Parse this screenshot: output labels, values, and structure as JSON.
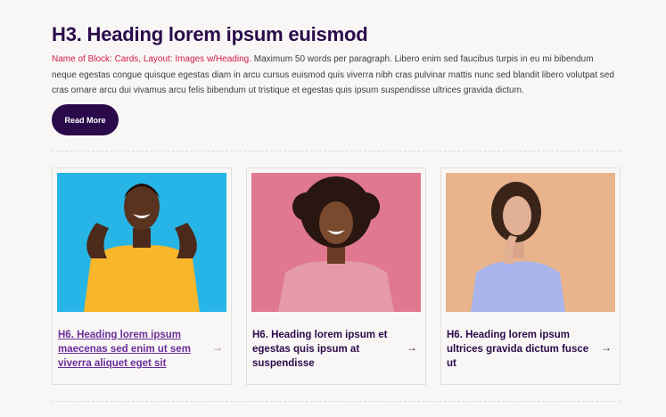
{
  "header": {
    "title": "H3. Heading lorem ipsum euismod",
    "paragraph_highlight": "Name of Block: Cards, Layout: Images w/Heading.",
    "paragraph_body": " Maximum 50 words per paragraph. Libero enim sed faucibus turpis in eu mi bibendum neque egestas congue quisque egestas diam in arcu cursus euismod quis viverra nibh cras pulvinar mattis nunc sed blandit libero volutpat sed cras ornare arcu dui vivamus arcu felis bibendum ut tristique et egestas quis ipsum suspendisse ultrices gravida dictum.",
    "button_label": "Read More"
  },
  "cards": [
    {
      "heading": "H6. Heading lorem ipsum maecenas sed enim ut sem viverra aliquet eget sit",
      "arrow": "→",
      "image": "man-in-yellow-shirt-pointing-at-smile"
    },
    {
      "heading": "H6. Heading lorem ipsum et egestas quis ipsum at suspendisse",
      "arrow": "→",
      "image": "woman-curly-hair-pink-sweater"
    },
    {
      "heading": "H6. Heading lorem ipsum ultrices gravida dictum fusce ut",
      "arrow": "→",
      "image": "woman-thinking-blue-cardigan"
    }
  ],
  "colors": {
    "accent": "#2a0a4a",
    "highlight": "#d11a4c",
    "link": "#6a2d9a",
    "background": "#f9f7f5"
  }
}
